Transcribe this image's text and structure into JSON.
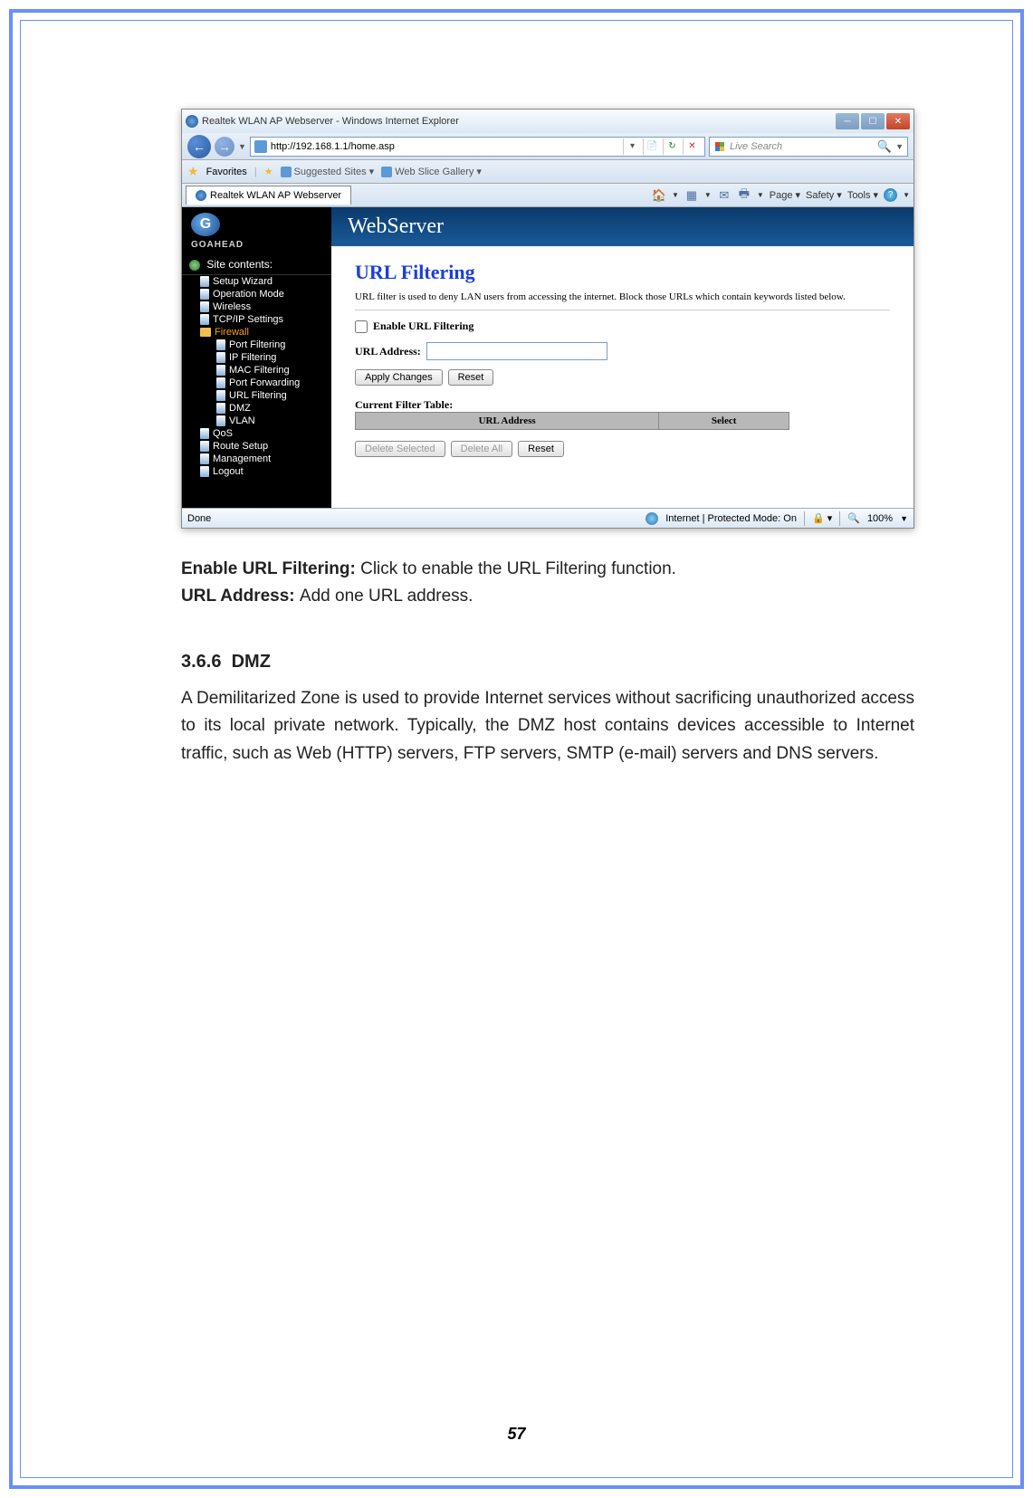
{
  "browser": {
    "title": "Realtek WLAN AP Webserver - Windows Internet Explorer",
    "url": "http://192.168.1.1/home.asp",
    "searchPlaceholder": "Live Search",
    "favorites": "Favorites",
    "suggestedSites": "Suggested Sites",
    "webSliceGallery": "Web Slice Gallery",
    "tabTitle": "Realtek WLAN AP Webserver",
    "toolMenu": {
      "page": "Page",
      "safety": "Safety",
      "tools": "Tools"
    },
    "statusLeft": "Done",
    "statusProtected": "Internet | Protected Mode: On",
    "zoom": "100%"
  },
  "webserver": {
    "logoText": "GOAHEAD",
    "banner": "WebServer",
    "sidebarTitle": "Site contents:",
    "tree": {
      "setupWizard": "Setup Wizard",
      "operationMode": "Operation Mode",
      "wireless": "Wireless",
      "tcpip": "TCP/IP Settings",
      "firewall": "Firewall",
      "portFiltering": "Port Filtering",
      "ipFiltering": "IP Filtering",
      "macFiltering": "MAC Filtering",
      "portForwarding": "Port Forwarding",
      "urlFiltering": "URL Filtering",
      "dmz": "DMZ",
      "vlan": "VLAN",
      "qos": "QoS",
      "routeSetup": "Route Setup",
      "management": "Management",
      "logout": "Logout"
    },
    "page": {
      "title": "URL Filtering",
      "desc": "URL filter is used to deny LAN users from accessing the internet. Block those URLs which contain keywords listed below.",
      "enableLabel": "Enable URL Filtering",
      "urlAddressLabel": "URL Address:",
      "applyChanges": "Apply Changes",
      "reset": "Reset",
      "tableCaption": "Current Filter Table:",
      "colUrl": "URL Address",
      "colSelect": "Select",
      "deleteSelected": "Delete Selected",
      "deleteAll": "Delete All",
      "reset2": "Reset"
    }
  },
  "doc": {
    "line1label": "Enable URL Filtering: ",
    "line1text": "Click to enable the URL Filtering function.",
    "line2label": "URL Address: ",
    "line2text": "Add one URL address.",
    "sectionNum": "3.6.6",
    "sectionTitle": "DMZ",
    "para": "A Demilitarized Zone is used to provide Internet services without sacrificing unauthorized access to its local private network. Typically, the DMZ host contains devices accessible to Internet traffic, such as Web (HTTP) servers, FTP servers, SMTP (e-mail) servers and DNS servers.",
    "pageNum": "57"
  }
}
